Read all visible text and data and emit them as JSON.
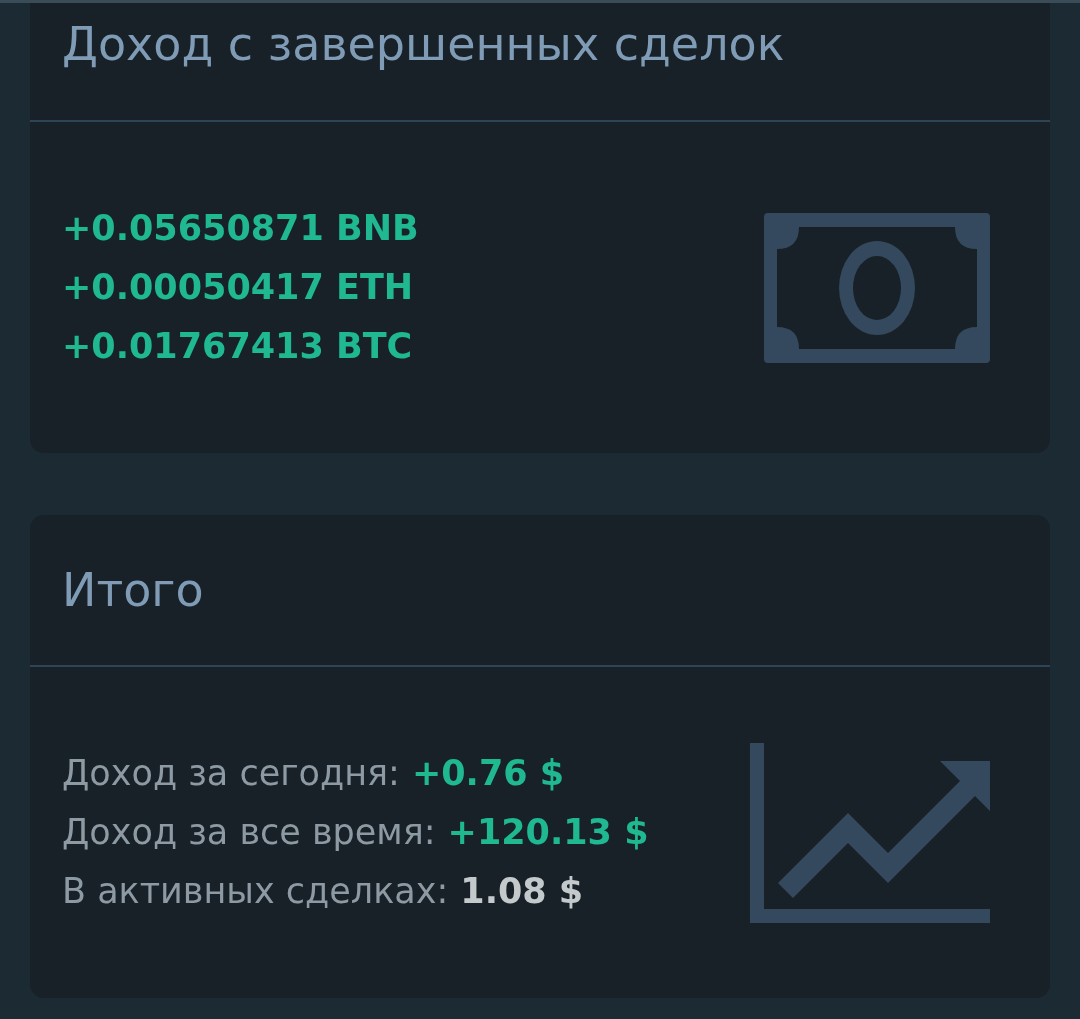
{
  "cards": [
    {
      "title": "Доход с завершенных сделок",
      "kind": "amounts",
      "lines": [
        {
          "value": "+0.05650871 BNB",
          "color": "#1fb890"
        },
        {
          "value": "+0.00050417 ETH",
          "color": "#1fb890"
        },
        {
          "value": "+0.01767413 BTC",
          "color": "#1fb890"
        }
      ]
    },
    {
      "title": "Итого",
      "kind": "summary",
      "lines": [
        {
          "label": "Доход за сегодня:",
          "value": "+0.76 $",
          "color": "#1fb890"
        },
        {
          "label": "Доход за все время:",
          "value": "+120.13 $",
          "color": "#1fb890"
        },
        {
          "label": "В активных сделках:",
          "value": "1.08 $",
          "color": "#c4c9cc"
        }
      ]
    }
  ]
}
